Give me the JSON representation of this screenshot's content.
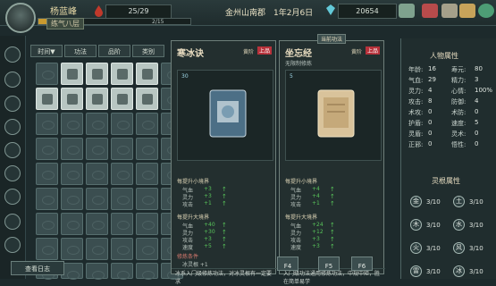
{
  "player": {
    "name": "杨蓝峰",
    "title": "练气八层",
    "hp_text": "2/15",
    "hp_fraction": 0.13
  },
  "qi": {
    "value": "25/29"
  },
  "location": {
    "text": "金州山南郡　1年2月6日"
  },
  "money": {
    "value": "20654"
  },
  "filters": [
    "时间▼",
    "功法",
    "品阶",
    "类别"
  ],
  "sidebar_icons": [
    "back-icon",
    "compass-icon",
    "bag-icon",
    "book-icon",
    "sword-icon",
    "scroll-icon",
    "map-icon",
    "flag-icon"
  ],
  "panel_left": {
    "name": "寒冰诀",
    "rank_label": "黄阶",
    "tag": "上品",
    "level": "30",
    "section_small": "每提升小境界",
    "section_big": "每提升大境界",
    "stats_small": [
      {
        "label": "气血",
        "value": "+3"
      },
      {
        "label": "灵力",
        "value": "+3"
      },
      {
        "label": "攻击",
        "value": "+1"
      }
    ],
    "stats_big": [
      {
        "label": "气血",
        "value": "+40"
      },
      {
        "label": "灵力",
        "value": "+30"
      },
      {
        "label": "攻击",
        "value": "+3"
      },
      {
        "label": "速度",
        "value": "+5"
      }
    ],
    "cond_title": "修炼条件",
    "cond_text": "冰灵根 +1",
    "desc": "冰系入门级修炼功法，对冰灵根有一定要求"
  },
  "panel_right": {
    "name": "坐忘经",
    "rank_label": "黄阶",
    "tag": "上品",
    "header_label": "当前功法",
    "sub": "无限制修炼",
    "level": "5",
    "section_small": "每提升小境界",
    "section_big": "每提升大境界",
    "stats_small": [
      {
        "label": "气血",
        "value": "+4"
      },
      {
        "label": "灵力",
        "value": "+4"
      },
      {
        "label": "攻击",
        "value": "+1"
      }
    ],
    "stats_big": [
      {
        "label": "气血",
        "value": "+24"
      },
      {
        "label": "灵力",
        "value": "+12"
      },
      {
        "label": "攻击",
        "value": "+3"
      },
      {
        "label": "速度",
        "value": "+3"
      }
    ],
    "desc": "入门级功法通用修炼功法，中规中矩，胜在简单易学"
  },
  "attributes": {
    "title": "人物属性",
    "rows": [
      {
        "l1": "年龄:",
        "v1": "16",
        "l2": "寿元:",
        "v2": "80"
      },
      {
        "l1": "气血:",
        "v1": "29",
        "l2": "精力:",
        "v2": "3"
      },
      {
        "l1": "灵力:",
        "v1": "4",
        "l2": "心情:",
        "v2": "100%"
      },
      {
        "l1": "攻击:",
        "v1": "8",
        "l2": "防御:",
        "v2": "4"
      },
      {
        "l1": "术攻:",
        "v1": "0",
        "l2": "术防:",
        "v2": "0"
      },
      {
        "l1": "护盾:",
        "v1": "0",
        "l2": "速度:",
        "v2": "5"
      },
      {
        "l1": "灵盾:",
        "v1": "0",
        "l2": "灵术:",
        "v2": "0"
      },
      {
        "l1": "正邪:",
        "v1": "0",
        "l2": "悟性:",
        "v2": "0"
      }
    ]
  },
  "elements": {
    "title": "灵根属性",
    "items": [
      {
        "glyph": "金",
        "value": "3/10"
      },
      {
        "glyph": "土",
        "value": "3/10"
      },
      {
        "glyph": "木",
        "value": "3/10"
      },
      {
        "glyph": "水",
        "value": "3/10"
      },
      {
        "glyph": "火",
        "value": "3/10"
      },
      {
        "glyph": "风",
        "value": "3/10"
      },
      {
        "glyph": "雷",
        "value": "3/10"
      },
      {
        "glyph": "冰",
        "value": "3/10"
      }
    ]
  },
  "fkeys": [
    "F4",
    "F5",
    "F6"
  ],
  "log_button": "查看日志",
  "colors": {
    "accent_gold": "#c99a2f",
    "stat_green": "#58c35a",
    "tag_red": "#b8323b"
  }
}
